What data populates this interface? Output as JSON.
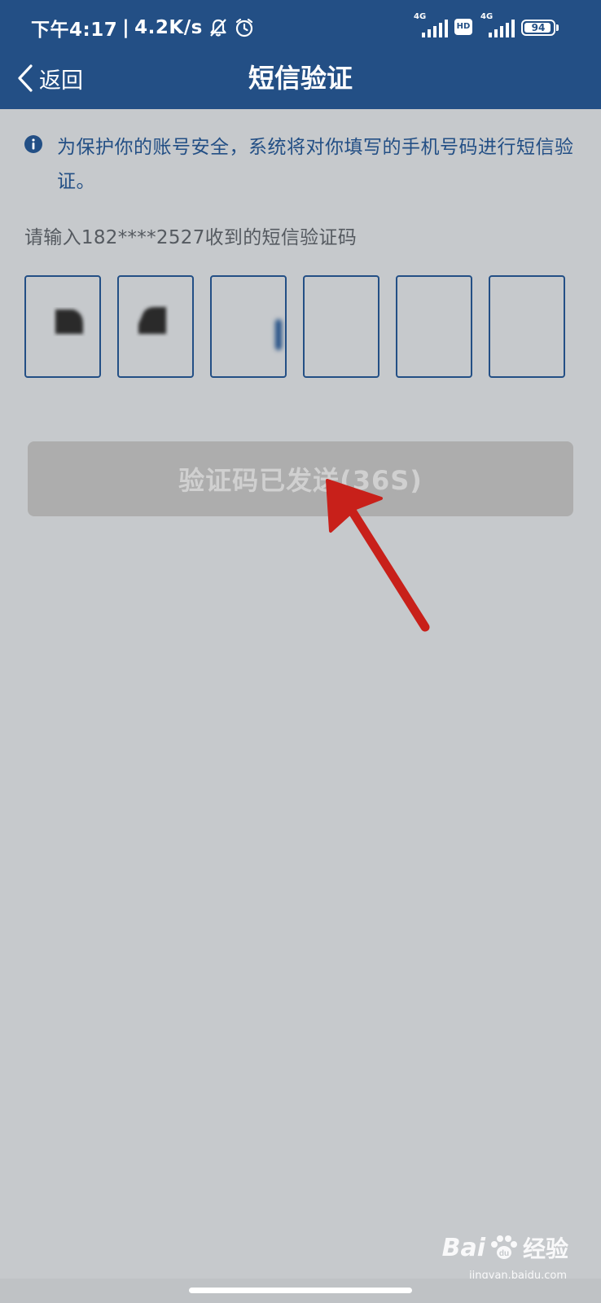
{
  "status_bar": {
    "time": "下午4:17",
    "separator": "|",
    "speed": "4.2K/s",
    "sim1_network": "4G",
    "hd_badge": "HD",
    "sim2_network": "4G",
    "battery": "94",
    "battery_level": 0.94
  },
  "header": {
    "back_label": "返回",
    "title": "短信验证"
  },
  "notice": {
    "text": "为保护你的账号安全，系统将对你填写的手机号码进行短信验证。"
  },
  "prompt": {
    "text": "请输入182****2527收到的短信验证码"
  },
  "code_input": {
    "digits": [
      "",
      "",
      "",
      "",
      "",
      ""
    ]
  },
  "resend_button": {
    "label": "验证码已发送(36S)"
  },
  "watermark": {
    "brand": "Bai",
    "suffix": "经验",
    "url": "jingyan.baidu.com"
  },
  "colors": {
    "header_bg": "#234f85",
    "page_bg": "#c6c9cc",
    "accent": "#234f85",
    "button_disabled_bg": "#adadad",
    "annotation_arrow": "#c8201a"
  }
}
